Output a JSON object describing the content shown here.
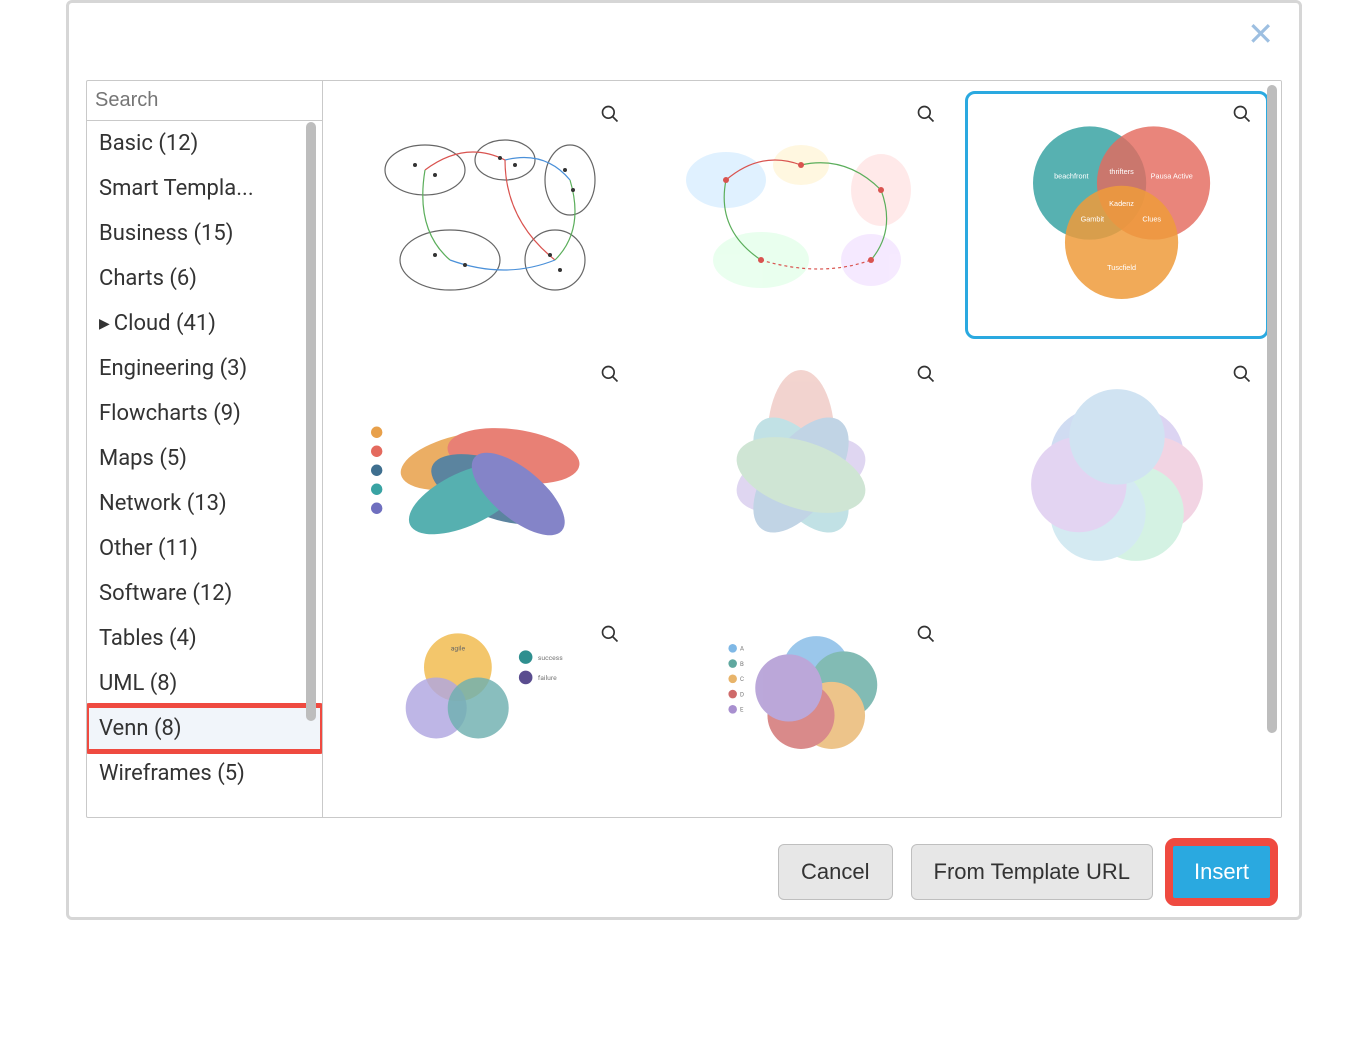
{
  "search": {
    "placeholder": "Search"
  },
  "categories": [
    {
      "label": "Basic (12)",
      "expandable": false,
      "selected": false,
      "highlighted": false
    },
    {
      "label": "Smart Templa...",
      "expandable": false,
      "selected": false,
      "highlighted": false
    },
    {
      "label": "Business (15)",
      "expandable": false,
      "selected": false,
      "highlighted": false
    },
    {
      "label": "Charts (6)",
      "expandable": false,
      "selected": false,
      "highlighted": false
    },
    {
      "label": "Cloud (41)",
      "expandable": true,
      "selected": false,
      "highlighted": false
    },
    {
      "label": "Engineering (3)",
      "expandable": false,
      "selected": false,
      "highlighted": false
    },
    {
      "label": "Flowcharts (9)",
      "expandable": false,
      "selected": false,
      "highlighted": false
    },
    {
      "label": "Maps (5)",
      "expandable": false,
      "selected": false,
      "highlighted": false
    },
    {
      "label": "Network (13)",
      "expandable": false,
      "selected": false,
      "highlighted": false
    },
    {
      "label": "Other (11)",
      "expandable": false,
      "selected": false,
      "highlighted": false
    },
    {
      "label": "Software (12)",
      "expandable": false,
      "selected": false,
      "highlighted": false
    },
    {
      "label": "Tables (4)",
      "expandable": false,
      "selected": false,
      "highlighted": false
    },
    {
      "label": "UML (8)",
      "expandable": false,
      "selected": false,
      "highlighted": false
    },
    {
      "label": "Venn (8)",
      "expandable": false,
      "selected": true,
      "highlighted": true
    },
    {
      "label": "Wireframes (5)",
      "expandable": false,
      "selected": false,
      "highlighted": false
    }
  ],
  "footer": {
    "cancel_label": "Cancel",
    "from_url_label": "From Template URL",
    "insert_label": "Insert",
    "insert_highlighted": true
  },
  "tiles": [
    {
      "selected": false
    },
    {
      "selected": false
    },
    {
      "selected": true
    },
    {
      "selected": false
    },
    {
      "selected": false
    },
    {
      "selected": false
    },
    {
      "selected": false
    },
    {
      "selected": false
    }
  ]
}
